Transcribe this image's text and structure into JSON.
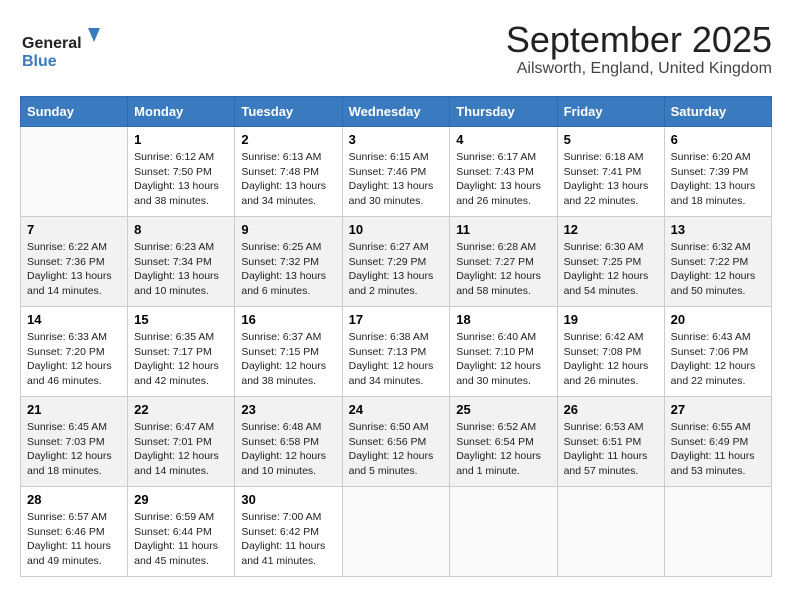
{
  "header": {
    "logo_general": "General",
    "logo_blue": "Blue",
    "title": "September 2025",
    "subtitle": "Ailsworth, England, United Kingdom"
  },
  "weekdays": [
    "Sunday",
    "Monday",
    "Tuesday",
    "Wednesday",
    "Thursday",
    "Friday",
    "Saturday"
  ],
  "weeks": [
    [
      {
        "day": "",
        "sunrise": "",
        "sunset": "",
        "daylight": ""
      },
      {
        "day": "1",
        "sunrise": "Sunrise: 6:12 AM",
        "sunset": "Sunset: 7:50 PM",
        "daylight": "Daylight: 13 hours and 38 minutes."
      },
      {
        "day": "2",
        "sunrise": "Sunrise: 6:13 AM",
        "sunset": "Sunset: 7:48 PM",
        "daylight": "Daylight: 13 hours and 34 minutes."
      },
      {
        "day": "3",
        "sunrise": "Sunrise: 6:15 AM",
        "sunset": "Sunset: 7:46 PM",
        "daylight": "Daylight: 13 hours and 30 minutes."
      },
      {
        "day": "4",
        "sunrise": "Sunrise: 6:17 AM",
        "sunset": "Sunset: 7:43 PM",
        "daylight": "Daylight: 13 hours and 26 minutes."
      },
      {
        "day": "5",
        "sunrise": "Sunrise: 6:18 AM",
        "sunset": "Sunset: 7:41 PM",
        "daylight": "Daylight: 13 hours and 22 minutes."
      },
      {
        "day": "6",
        "sunrise": "Sunrise: 6:20 AM",
        "sunset": "Sunset: 7:39 PM",
        "daylight": "Daylight: 13 hours and 18 minutes."
      }
    ],
    [
      {
        "day": "7",
        "sunrise": "Sunrise: 6:22 AM",
        "sunset": "Sunset: 7:36 PM",
        "daylight": "Daylight: 13 hours and 14 minutes."
      },
      {
        "day": "8",
        "sunrise": "Sunrise: 6:23 AM",
        "sunset": "Sunset: 7:34 PM",
        "daylight": "Daylight: 13 hours and 10 minutes."
      },
      {
        "day": "9",
        "sunrise": "Sunrise: 6:25 AM",
        "sunset": "Sunset: 7:32 PM",
        "daylight": "Daylight: 13 hours and 6 minutes."
      },
      {
        "day": "10",
        "sunrise": "Sunrise: 6:27 AM",
        "sunset": "Sunset: 7:29 PM",
        "daylight": "Daylight: 13 hours and 2 minutes."
      },
      {
        "day": "11",
        "sunrise": "Sunrise: 6:28 AM",
        "sunset": "Sunset: 7:27 PM",
        "daylight": "Daylight: 12 hours and 58 minutes."
      },
      {
        "day": "12",
        "sunrise": "Sunrise: 6:30 AM",
        "sunset": "Sunset: 7:25 PM",
        "daylight": "Daylight: 12 hours and 54 minutes."
      },
      {
        "day": "13",
        "sunrise": "Sunrise: 6:32 AM",
        "sunset": "Sunset: 7:22 PM",
        "daylight": "Daylight: 12 hours and 50 minutes."
      }
    ],
    [
      {
        "day": "14",
        "sunrise": "Sunrise: 6:33 AM",
        "sunset": "Sunset: 7:20 PM",
        "daylight": "Daylight: 12 hours and 46 minutes."
      },
      {
        "day": "15",
        "sunrise": "Sunrise: 6:35 AM",
        "sunset": "Sunset: 7:17 PM",
        "daylight": "Daylight: 12 hours and 42 minutes."
      },
      {
        "day": "16",
        "sunrise": "Sunrise: 6:37 AM",
        "sunset": "Sunset: 7:15 PM",
        "daylight": "Daylight: 12 hours and 38 minutes."
      },
      {
        "day": "17",
        "sunrise": "Sunrise: 6:38 AM",
        "sunset": "Sunset: 7:13 PM",
        "daylight": "Daylight: 12 hours and 34 minutes."
      },
      {
        "day": "18",
        "sunrise": "Sunrise: 6:40 AM",
        "sunset": "Sunset: 7:10 PM",
        "daylight": "Daylight: 12 hours and 30 minutes."
      },
      {
        "day": "19",
        "sunrise": "Sunrise: 6:42 AM",
        "sunset": "Sunset: 7:08 PM",
        "daylight": "Daylight: 12 hours and 26 minutes."
      },
      {
        "day": "20",
        "sunrise": "Sunrise: 6:43 AM",
        "sunset": "Sunset: 7:06 PM",
        "daylight": "Daylight: 12 hours and 22 minutes."
      }
    ],
    [
      {
        "day": "21",
        "sunrise": "Sunrise: 6:45 AM",
        "sunset": "Sunset: 7:03 PM",
        "daylight": "Daylight: 12 hours and 18 minutes."
      },
      {
        "day": "22",
        "sunrise": "Sunrise: 6:47 AM",
        "sunset": "Sunset: 7:01 PM",
        "daylight": "Daylight: 12 hours and 14 minutes."
      },
      {
        "day": "23",
        "sunrise": "Sunrise: 6:48 AM",
        "sunset": "Sunset: 6:58 PM",
        "daylight": "Daylight: 12 hours and 10 minutes."
      },
      {
        "day": "24",
        "sunrise": "Sunrise: 6:50 AM",
        "sunset": "Sunset: 6:56 PM",
        "daylight": "Daylight: 12 hours and 5 minutes."
      },
      {
        "day": "25",
        "sunrise": "Sunrise: 6:52 AM",
        "sunset": "Sunset: 6:54 PM",
        "daylight": "Daylight: 12 hours and 1 minute."
      },
      {
        "day": "26",
        "sunrise": "Sunrise: 6:53 AM",
        "sunset": "Sunset: 6:51 PM",
        "daylight": "Daylight: 11 hours and 57 minutes."
      },
      {
        "day": "27",
        "sunrise": "Sunrise: 6:55 AM",
        "sunset": "Sunset: 6:49 PM",
        "daylight": "Daylight: 11 hours and 53 minutes."
      }
    ],
    [
      {
        "day": "28",
        "sunrise": "Sunrise: 6:57 AM",
        "sunset": "Sunset: 6:46 PM",
        "daylight": "Daylight: 11 hours and 49 minutes."
      },
      {
        "day": "29",
        "sunrise": "Sunrise: 6:59 AM",
        "sunset": "Sunset: 6:44 PM",
        "daylight": "Daylight: 11 hours and 45 minutes."
      },
      {
        "day": "30",
        "sunrise": "Sunrise: 7:00 AM",
        "sunset": "Sunset: 6:42 PM",
        "daylight": "Daylight: 11 hours and 41 minutes."
      },
      {
        "day": "",
        "sunrise": "",
        "sunset": "",
        "daylight": ""
      },
      {
        "day": "",
        "sunrise": "",
        "sunset": "",
        "daylight": ""
      },
      {
        "day": "",
        "sunrise": "",
        "sunset": "",
        "daylight": ""
      },
      {
        "day": "",
        "sunrise": "",
        "sunset": "",
        "daylight": ""
      }
    ]
  ]
}
